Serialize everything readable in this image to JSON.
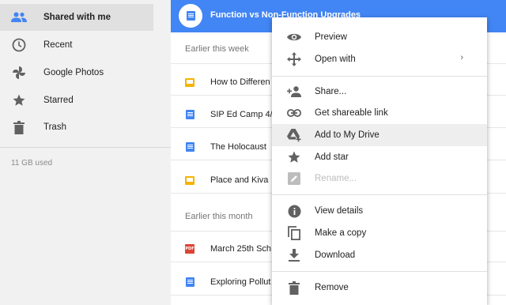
{
  "sidebar": {
    "items": [
      {
        "label": "Shared with me",
        "icon": "people-icon",
        "active": true
      },
      {
        "label": "Recent",
        "icon": "clock-icon"
      },
      {
        "label": "Google Photos",
        "icon": "pinwheel-icon"
      },
      {
        "label": "Starred",
        "icon": "star-icon"
      },
      {
        "label": "Trash",
        "icon": "trash-icon"
      }
    ],
    "storage": "11 GB used"
  },
  "file_list": {
    "selected_file": "Function vs Non-Function Upgrades",
    "sections": [
      {
        "label": "Earlier this week",
        "files": [
          {
            "name": "How to Differen",
            "type": "slides"
          },
          {
            "name": "SIP Ed Camp 4/",
            "type": "doc"
          },
          {
            "name": "The Holocaust",
            "type": "doc"
          },
          {
            "name": "Place and Kiva",
            "type": "slides"
          }
        ]
      },
      {
        "label": "Earlier this month",
        "files": [
          {
            "name": "March 25th Sch",
            "type": "pdf"
          },
          {
            "name": "Exploring Pollut",
            "type": "doc"
          }
        ]
      }
    ]
  },
  "context_menu": {
    "items": [
      {
        "label": "Preview",
        "icon": "eye-icon"
      },
      {
        "label": "Open with",
        "icon": "move-arrows-icon",
        "submenu_arrow": "›"
      },
      {
        "label": "Share...",
        "icon": "person-add-icon"
      },
      {
        "label": "Get shareable link",
        "icon": "link-icon"
      },
      {
        "label": "Add to My Drive",
        "icon": "drive-add-icon",
        "hovered": true
      },
      {
        "label": "Add star",
        "icon": "star-icon"
      },
      {
        "label": "Rename...",
        "icon": "pencil-icon",
        "disabled": true
      },
      {
        "label": "View details",
        "icon": "info-icon"
      },
      {
        "label": "Make a copy",
        "icon": "copy-icon"
      },
      {
        "label": "Download",
        "icon": "download-icon"
      },
      {
        "label": "Remove",
        "icon": "trash-icon"
      }
    ]
  },
  "colors": {
    "accent": "#4285f4",
    "sidebar_bg": "#f1f1f1",
    "icon_gray": "#616161"
  }
}
